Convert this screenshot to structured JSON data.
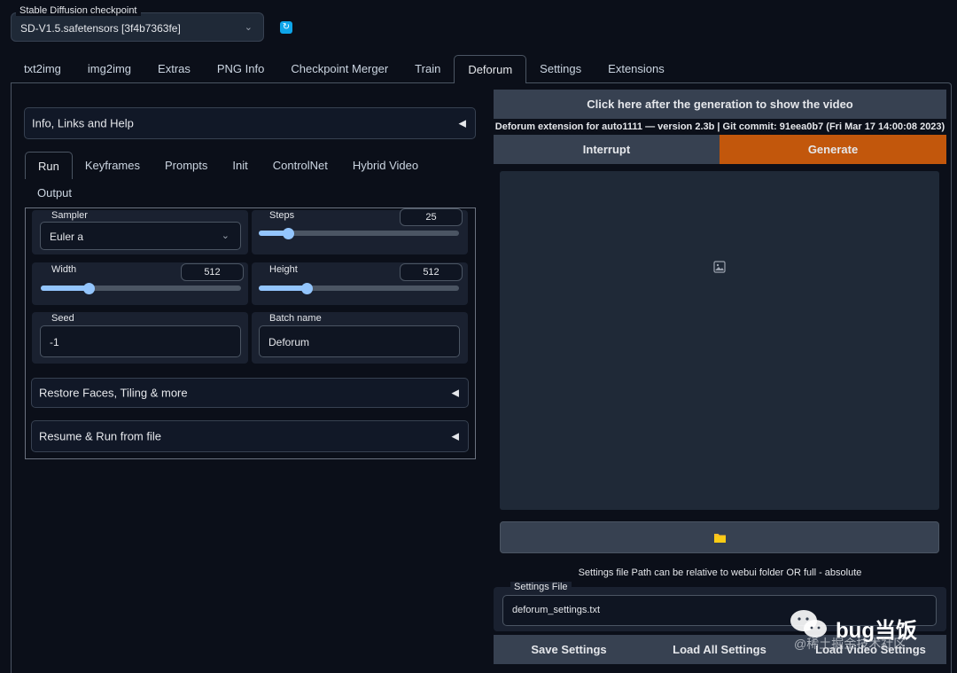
{
  "checkpoint": {
    "label": "Stable Diffusion checkpoint",
    "value": "SD-V1.5.safetensors [3f4b7363fe]"
  },
  "icons": {
    "refresh": "refresh-icon",
    "chevron": "chevron-down-icon",
    "triangle": "triangle-left-icon",
    "image": "image-icon",
    "folder": "folder-icon",
    "wechat": "wechat-icon"
  },
  "top_tabs": [
    "txt2img",
    "img2img",
    "Extras",
    "PNG Info",
    "Checkpoint Merger",
    "Train",
    "Deforum",
    "Settings",
    "Extensions"
  ],
  "top_tab_active": "Deforum",
  "info_accordion": "Info, Links and Help",
  "sub_tabs": [
    "Run",
    "Keyframes",
    "Prompts",
    "Init",
    "ControlNet",
    "Hybrid Video",
    "Output"
  ],
  "sub_tab_active": "Run",
  "run": {
    "sampler": {
      "label": "Sampler",
      "value": "Euler a"
    },
    "steps": {
      "label": "Steps",
      "value": "25",
      "fraction": 0.15
    },
    "width": {
      "label": "Width",
      "value": "512",
      "fraction": 0.24
    },
    "height": {
      "label": "Height",
      "value": "512",
      "fraction": 0.24
    },
    "seed": {
      "label": "Seed",
      "value": "-1"
    },
    "batch_name": {
      "label": "Batch name",
      "value": "Deforum"
    }
  },
  "restore_accordion": "Restore Faces, Tiling & more",
  "resume_accordion": "Resume & Run from file",
  "right": {
    "show_video": "Click here after the generation to show the video",
    "version": "Deforum extension for auto1111 — version 2.3b | Git commit: 91eea0b7 (Fri Mar 17 14:00:08 2023)",
    "interrupt": "Interrupt",
    "generate": "Generate",
    "settings_note": "Settings file Path can be relative to webui folder OR full - absolute",
    "settings_file_label": "Settings File",
    "settings_file_value": "deforum_settings.txt",
    "save_settings": "Save Settings",
    "load_all_settings": "Load All Settings",
    "load_video_settings": "Load Video Settings"
  },
  "colors": {
    "generate": "#c2570c",
    "slider": "#93c5fd",
    "background": "#0b0f19"
  },
  "watermark": {
    "name": "bug当饭",
    "sub": "@稀土掘金技术社区"
  }
}
